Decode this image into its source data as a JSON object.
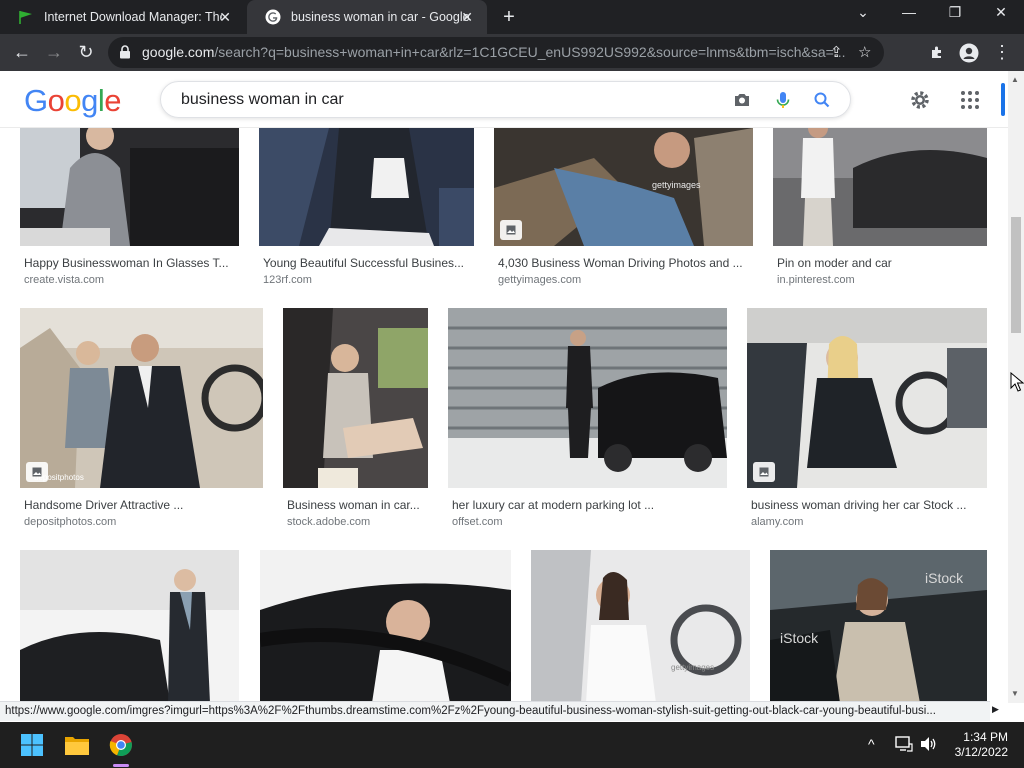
{
  "browser": {
    "tabs": [
      {
        "title": "Internet Download Manager: The",
        "active": false,
        "favicon": "idm-flag-icon"
      },
      {
        "title": "business woman in car - Google",
        "active": true,
        "favicon": "google-g-icon"
      }
    ],
    "url_domain": "google.com",
    "url_path": "/search?q=business+woman+in+car&rlz=1C1GCEU_enUS992US992&source=lnms&tbm=isch&sa=..."
  },
  "google": {
    "logo": [
      "G",
      "o",
      "o",
      "g",
      "l",
      "e"
    ],
    "query": "business woman in car"
  },
  "results": [
    {
      "title": "Happy Businesswoman In Glasses T...",
      "source": "create.vista.com"
    },
    {
      "title": "Young Beautiful Successful Busines...",
      "source": "123rf.com"
    },
    {
      "title": "4,030 Business Woman Driving Photos and ...",
      "source": "gettyimages.com"
    },
    {
      "title": "Pin on moder and car",
      "source": "in.pinterest.com"
    },
    {
      "title": "Handsome Driver Attractive ...",
      "source": "depositphotos.com"
    },
    {
      "title": "Business woman in car...",
      "source": "stock.adobe.com"
    },
    {
      "title": "her luxury car at modern parking lot ...",
      "source": "offset.com"
    },
    {
      "title": "business woman driving her car Stock ...",
      "source": "alamy.com"
    },
    {
      "title": "",
      "source": ""
    },
    {
      "title": "",
      "source": ""
    },
    {
      "title": "",
      "source": ""
    },
    {
      "title": "",
      "source": ""
    }
  ],
  "watermarks": {
    "getty": "gettyimages",
    "istock": "iStock",
    "deposit": "depositphotos"
  },
  "status_url": "https://www.google.com/imgres?imgurl=https%3A%2F%2Fthumbs.dreamstime.com%2Fz%2Fyoung-beautiful-business-woman-stylish-suit-getting-out-black-car-young-beautiful-busi...",
  "taskbar": {
    "time": "1:34 PM",
    "date": "3/12/2022"
  },
  "colors": {
    "chrome_dark": "#202124",
    "chrome_toolbar": "#35363a",
    "google_blue": "#4285f4",
    "link_gray": "#70757a"
  }
}
